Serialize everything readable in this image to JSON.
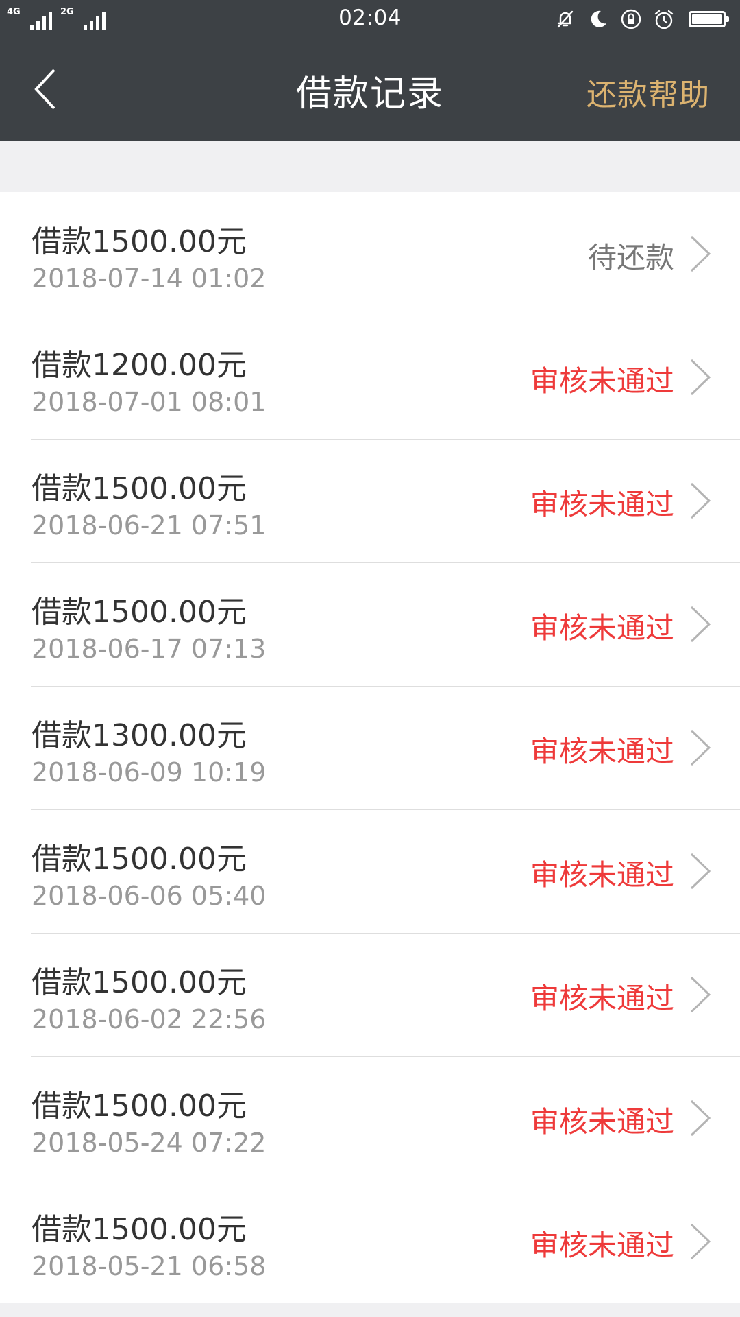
{
  "status_bar": {
    "time": "02:04",
    "signal_1_label": "4G",
    "signal_2_label": "2G",
    "icons": [
      "mute-icon",
      "moon-icon",
      "rotation-lock-icon",
      "alarm-icon",
      "battery-icon"
    ],
    "battery_level": 1.0
  },
  "nav": {
    "back_icon": "chevron-left-icon",
    "title": "借款记录",
    "help_label": "还款帮助"
  },
  "colors": {
    "header_bg": "#3d4145",
    "help_gold": "#dcb370",
    "status_pending": "#777777",
    "status_rejected": "#ee3a3a",
    "page_bg": "#f0f0f2"
  },
  "records": [
    {
      "title": "借款1500.00元",
      "date": "2018-07-14 01:02",
      "status": "待还款",
      "status_type": "pending"
    },
    {
      "title": "借款1200.00元",
      "date": "2018-07-01 08:01",
      "status": "审核未通过",
      "status_type": "rejected"
    },
    {
      "title": "借款1500.00元",
      "date": "2018-06-21 07:51",
      "status": "审核未通过",
      "status_type": "rejected"
    },
    {
      "title": "借款1500.00元",
      "date": "2018-06-17 07:13",
      "status": "审核未通过",
      "status_type": "rejected"
    },
    {
      "title": "借款1300.00元",
      "date": "2018-06-09 10:19",
      "status": "审核未通过",
      "status_type": "rejected"
    },
    {
      "title": "借款1500.00元",
      "date": "2018-06-06 05:40",
      "status": "审核未通过",
      "status_type": "rejected"
    },
    {
      "title": "借款1500.00元",
      "date": "2018-06-02 22:56",
      "status": "审核未通过",
      "status_type": "rejected"
    },
    {
      "title": "借款1500.00元",
      "date": "2018-05-24 07:22",
      "status": "审核未通过",
      "status_type": "rejected"
    },
    {
      "title": "借款1500.00元",
      "date": "2018-05-21 06:58",
      "status": "审核未通过",
      "status_type": "rejected"
    }
  ]
}
